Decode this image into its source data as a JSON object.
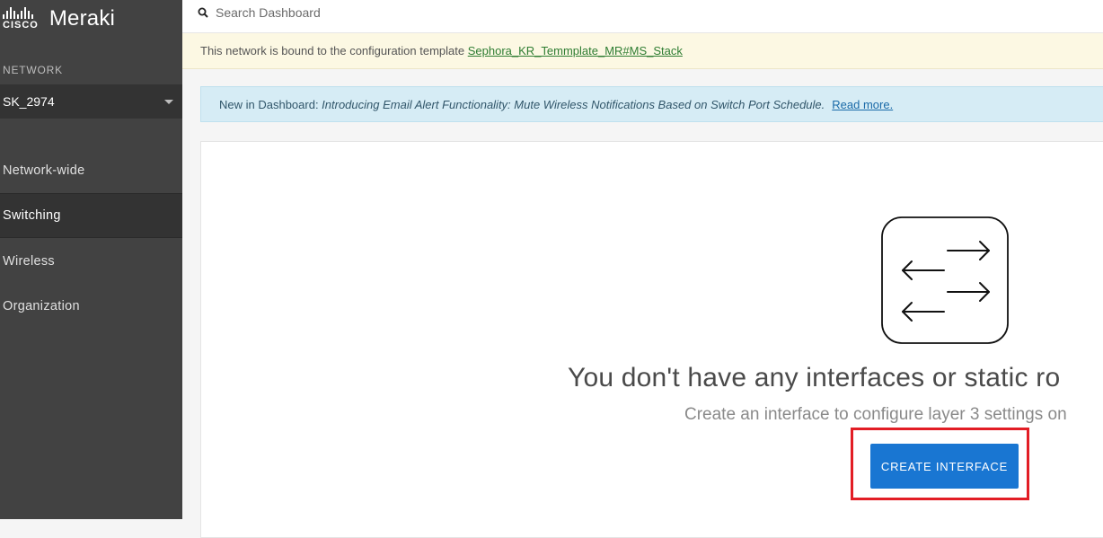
{
  "app": {
    "cisco_word": "CISCO",
    "brand": "Meraki"
  },
  "sidebar": {
    "network_label": "NETWORK",
    "network_value": "SK_2974",
    "items": [
      {
        "label": "Network-wide",
        "active": false
      },
      {
        "label": "Switching",
        "active": true
      },
      {
        "label": "Wireless",
        "active": false
      },
      {
        "label": "Organization",
        "active": false
      }
    ]
  },
  "search": {
    "placeholder": "Search Dashboard",
    "icon": "search-icon"
  },
  "template_banner": {
    "text": "This network is bound to the configuration template ",
    "link": "Sephora_KR_Temmplate_MR#MS_Stack"
  },
  "info_banner": {
    "prefix": "New in Dashboard: ",
    "message": "Introducing Email Alert Functionality: Mute Wireless Notifications Based on Switch Port Schedule.",
    "link": "Read more."
  },
  "empty_state": {
    "icon": "interfaces-arrows-icon",
    "headline": "You don't have any interfaces or static ro",
    "subline": "Create an interface to configure layer 3 settings on",
    "button": "CREATE INTERFACE"
  },
  "colors": {
    "sidebar_bg": "#424242",
    "primary": "#1976d2",
    "highlight": "#e21d25"
  }
}
